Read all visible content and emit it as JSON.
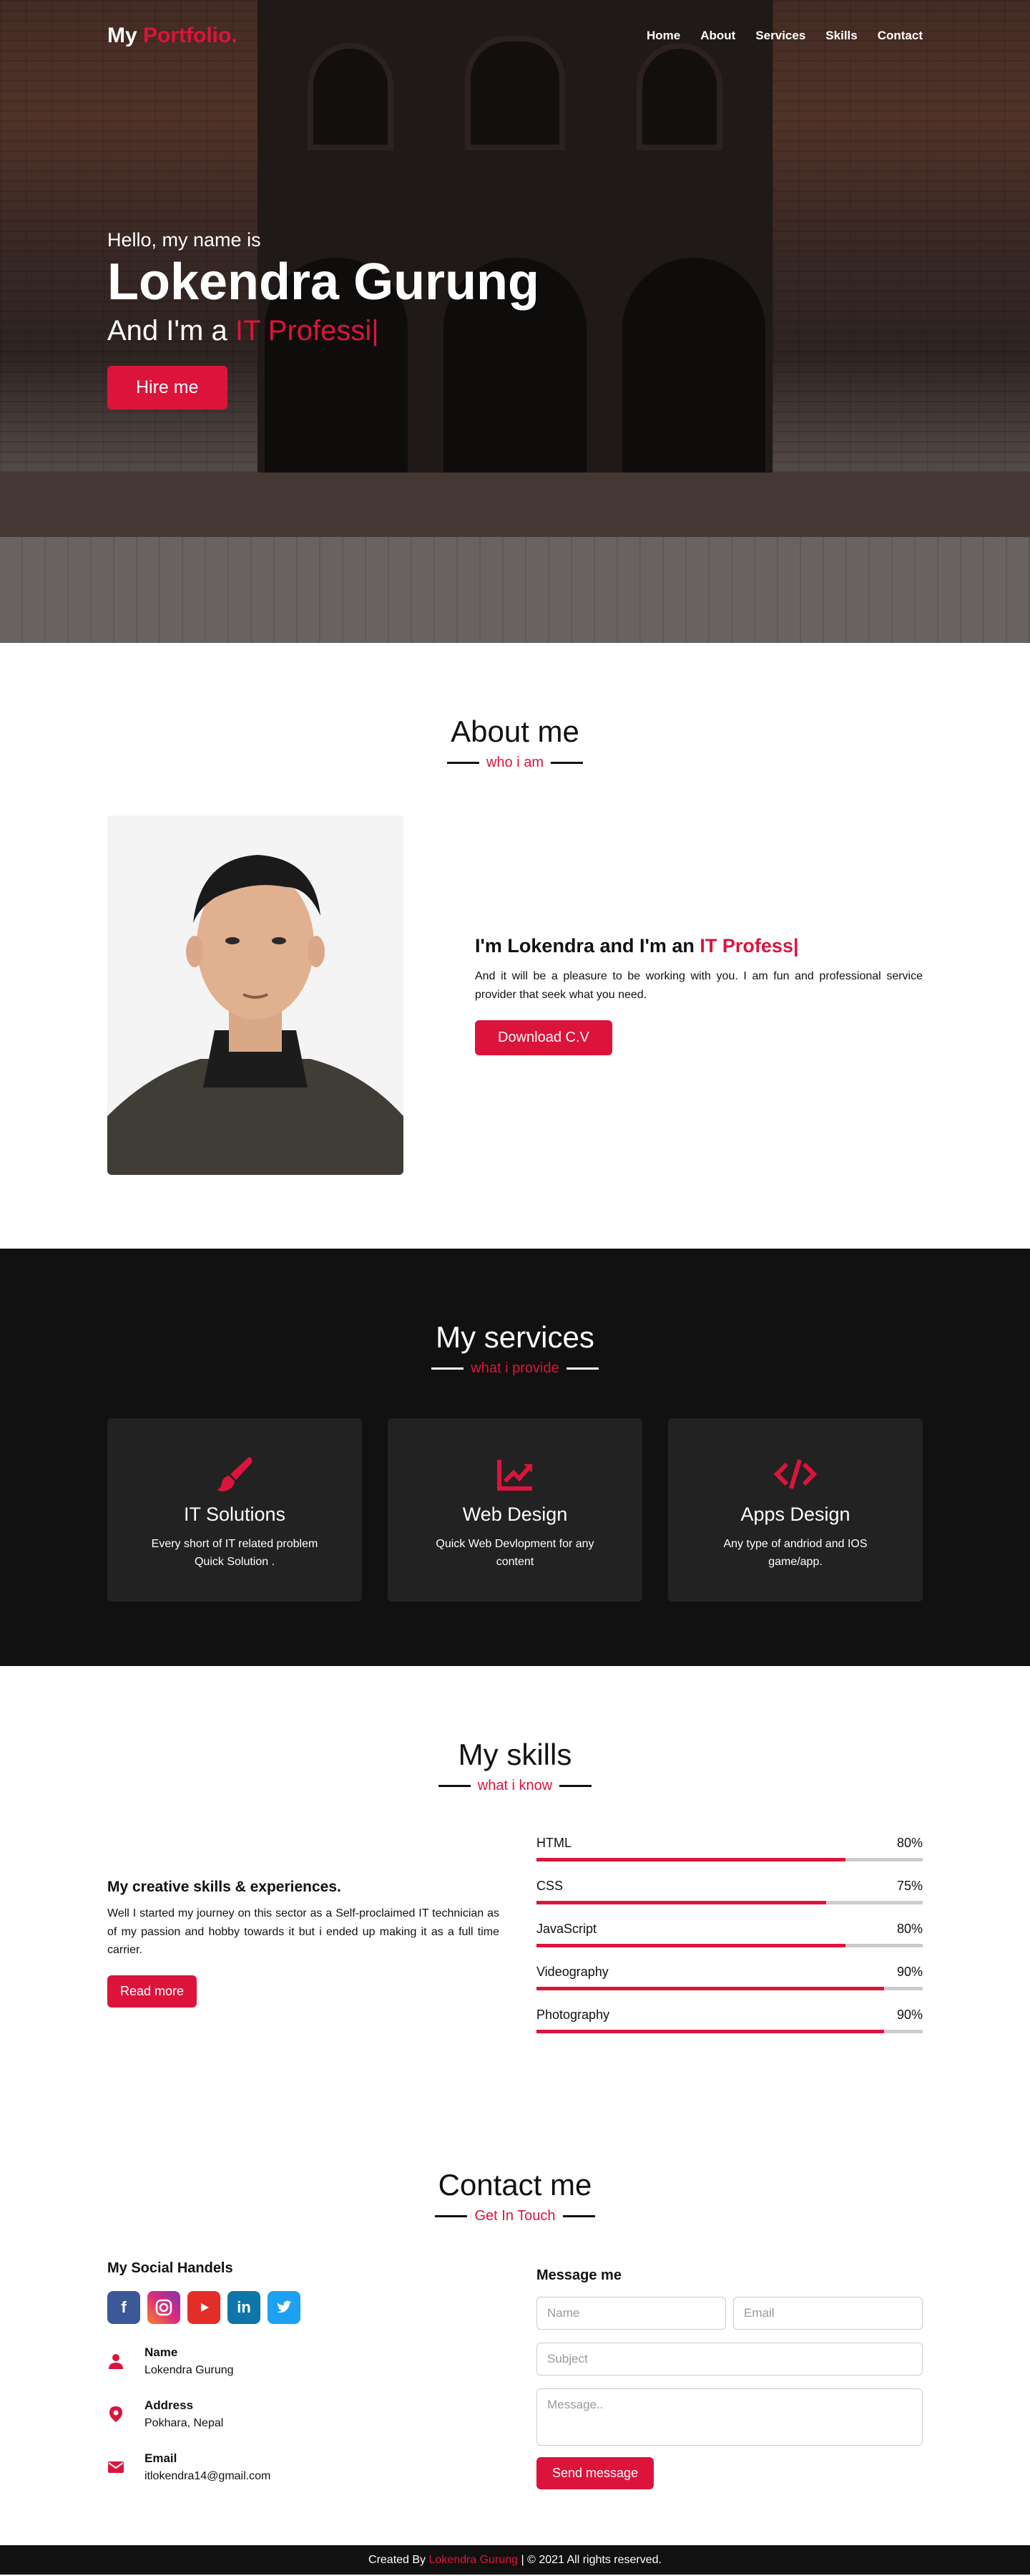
{
  "nav": {
    "logo_main": "My",
    "logo_accent": "Portfolio.",
    "links": [
      "Home",
      "About",
      "Services",
      "Skills",
      "Contact"
    ]
  },
  "hero": {
    "greeting": "Hello, my name is",
    "name": "Lokendra Gurung",
    "role_prefix": "And I'm a",
    "role_typed": "IT Professi|",
    "button": "Hire me"
  },
  "about": {
    "title": "About me",
    "subtitle": "who i am",
    "heading_prefix": "I'm Lokendra and I'm an",
    "heading_typed": "IT Profess|",
    "description": "And it will be a pleasure to be working with you. I am fun and professional service provider that seek what you need.",
    "button": "Download C.V"
  },
  "services": {
    "title": "My services",
    "subtitle": "what i provide",
    "cards": [
      {
        "icon": "paintbrush-icon",
        "title": "IT Solutions",
        "desc": "Every short of IT related problem Quick Solution ."
      },
      {
        "icon": "chart-line-icon",
        "title": "Web Design",
        "desc": "Quick Web Devlopment for any content"
      },
      {
        "icon": "code-icon",
        "title": "Apps Design",
        "desc": "Any type of andriod and IOS game/app."
      }
    ]
  },
  "skills": {
    "title": "My skills",
    "subtitle": "what i know",
    "heading": "My creative skills & experiences.",
    "description": "Well I started my journey on this sector as a Self-proclaimed IT technician as of my passion and hobby towards it but i ended up making it as a full time carrier.",
    "button": "Read more",
    "bars": [
      {
        "name": "HTML",
        "label": "80%",
        "value": 0.8
      },
      {
        "name": "CSS",
        "label": "75%",
        "value": 0.75
      },
      {
        "name": "JavaScript",
        "label": "80%",
        "value": 0.8
      },
      {
        "name": "Videography",
        "label": "90%",
        "value": 0.9
      },
      {
        "name": "Photography",
        "label": "90%",
        "value": 0.9
      }
    ]
  },
  "contact": {
    "title": "Contact me",
    "subtitle": "Get In Touch",
    "social_heading": "My Social Handels",
    "socials": [
      "facebook-icon",
      "instagram-icon",
      "youtube-icon",
      "linkedin-icon",
      "twitter-icon"
    ],
    "info": [
      {
        "label": "Name",
        "value": "Lokendra Gurung"
      },
      {
        "label": "Address",
        "value": "Pokhara, Nepal"
      },
      {
        "label": "Email",
        "value": "itlokendra14@gmail.com"
      }
    ],
    "form_heading": "Message me",
    "placeholders": {
      "name": "Name",
      "email": "Email",
      "subject": "Subject",
      "message": "Message.."
    },
    "send": "Send message"
  },
  "footer": {
    "prefix": "Created By",
    "author": "Lokendra Gurung",
    "suffix": "| © 2021 All rights reserved."
  },
  "colors": {
    "accent": "#dc143c",
    "dark": "#111111",
    "card": "#222222"
  }
}
